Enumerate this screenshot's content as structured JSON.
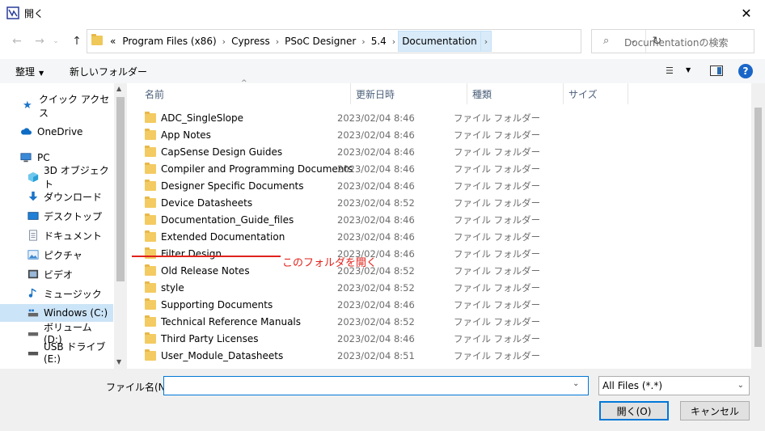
{
  "window": {
    "title": "開く"
  },
  "nav": {
    "back": "←",
    "forward": "→",
    "up": "↑",
    "dropdown": "⌄"
  },
  "address": {
    "crumbs": [
      "«",
      "Program Files (x86)",
      "Cypress",
      "PSoC Designer",
      "5.4",
      "Documentation"
    ],
    "separator": "›",
    "dropdown": "⌄",
    "refresh": "↻"
  },
  "search": {
    "placeholder": "Documentationの検索",
    "icon": "⌕"
  },
  "toolbar": {
    "organize": "整理",
    "new_folder": "新しいフォルダー",
    "help": "?"
  },
  "sidebar": {
    "items": [
      {
        "label": "クイック アクセス",
        "icon": "star-icon",
        "color": "#1a73c8"
      },
      {
        "label": "OneDrive",
        "icon": "cloud-icon",
        "color": "#0f6cc4"
      },
      {
        "label": "PC",
        "icon": "pc-icon",
        "color": "#2b7bd0"
      },
      {
        "label": "3D オブジェクト",
        "icon": "cube-icon",
        "color": "#2aa3d9"
      },
      {
        "label": "ダウンロード",
        "icon": "download-icon",
        "color": "#1a73c8"
      },
      {
        "label": "デスクトップ",
        "icon": "desktop-icon",
        "color": "#1f80d6"
      },
      {
        "label": "ドキュメント",
        "icon": "document-icon",
        "color": "#6d7f95"
      },
      {
        "label": "ピクチャ",
        "icon": "picture-icon",
        "color": "#3a87cf"
      },
      {
        "label": "ビデオ",
        "icon": "video-icon",
        "color": "#555555"
      },
      {
        "label": "ミュージック",
        "icon": "music-icon",
        "color": "#1a73c8"
      },
      {
        "label": "Windows (C:)",
        "icon": "drive-icon",
        "color": "#444444"
      },
      {
        "label": "ボリューム (D:)",
        "icon": "drive-icon",
        "color": "#444444"
      },
      {
        "label": "USB ドライブ (E:)",
        "icon": "usb-drive-icon",
        "color": "#444444"
      }
    ],
    "selected": "Windows (C:)"
  },
  "columns": {
    "name": "名前",
    "date": "更新日時",
    "type": "種類",
    "size": "サイズ"
  },
  "files": [
    {
      "name": "ADC_SingleSlope",
      "date": "2023/02/04 8:46",
      "type": "ファイル フォルダー"
    },
    {
      "name": "App Notes",
      "date": "2023/02/04 8:46",
      "type": "ファイル フォルダー"
    },
    {
      "name": "CapSense Design Guides",
      "date": "2023/02/04 8:46",
      "type": "ファイル フォルダー"
    },
    {
      "name": "Compiler and Programming Documents",
      "date": "2023/02/04 8:46",
      "type": "ファイル フォルダー"
    },
    {
      "name": "Designer Specific Documents",
      "date": "2023/02/04 8:46",
      "type": "ファイル フォルダー"
    },
    {
      "name": "Device Datasheets",
      "date": "2023/02/04 8:52",
      "type": "ファイル フォルダー"
    },
    {
      "name": "Documentation_Guide_files",
      "date": "2023/02/04 8:46",
      "type": "ファイル フォルダー"
    },
    {
      "name": "Extended Documentation",
      "date": "2023/02/04 8:46",
      "type": "ファイル フォルダー"
    },
    {
      "name": "Filter Design",
      "date": "2023/02/04 8:46",
      "type": "ファイル フォルダー"
    },
    {
      "name": "Old Release Notes",
      "date": "2023/02/04 8:52",
      "type": "ファイル フォルダー"
    },
    {
      "name": "style",
      "date": "2023/02/04 8:52",
      "type": "ファイル フォルダー"
    },
    {
      "name": "Supporting Documents",
      "date": "2023/02/04 8:46",
      "type": "ファイル フォルダー"
    },
    {
      "name": "Technical Reference Manuals",
      "date": "2023/02/04 8:52",
      "type": "ファイル フォルダー"
    },
    {
      "name": "Third Party Licenses",
      "date": "2023/02/04 8:46",
      "type": "ファイル フォルダー"
    },
    {
      "name": "User_Module_Datasheets",
      "date": "2023/02/04 8:51",
      "type": "ファイル フォルダー"
    }
  ],
  "annotation": {
    "text": "このフォルダを開く",
    "color": "#e0231c"
  },
  "bottom": {
    "filename_label": "ファイル名(N):",
    "filename_value": "",
    "filter": "All Files (*.*)",
    "open_button": "開く(O)",
    "cancel_button": "キャンセル"
  },
  "colors": {
    "accent": "#0078d7",
    "selection": "#cce4f7",
    "folder": "#f3cb62"
  }
}
